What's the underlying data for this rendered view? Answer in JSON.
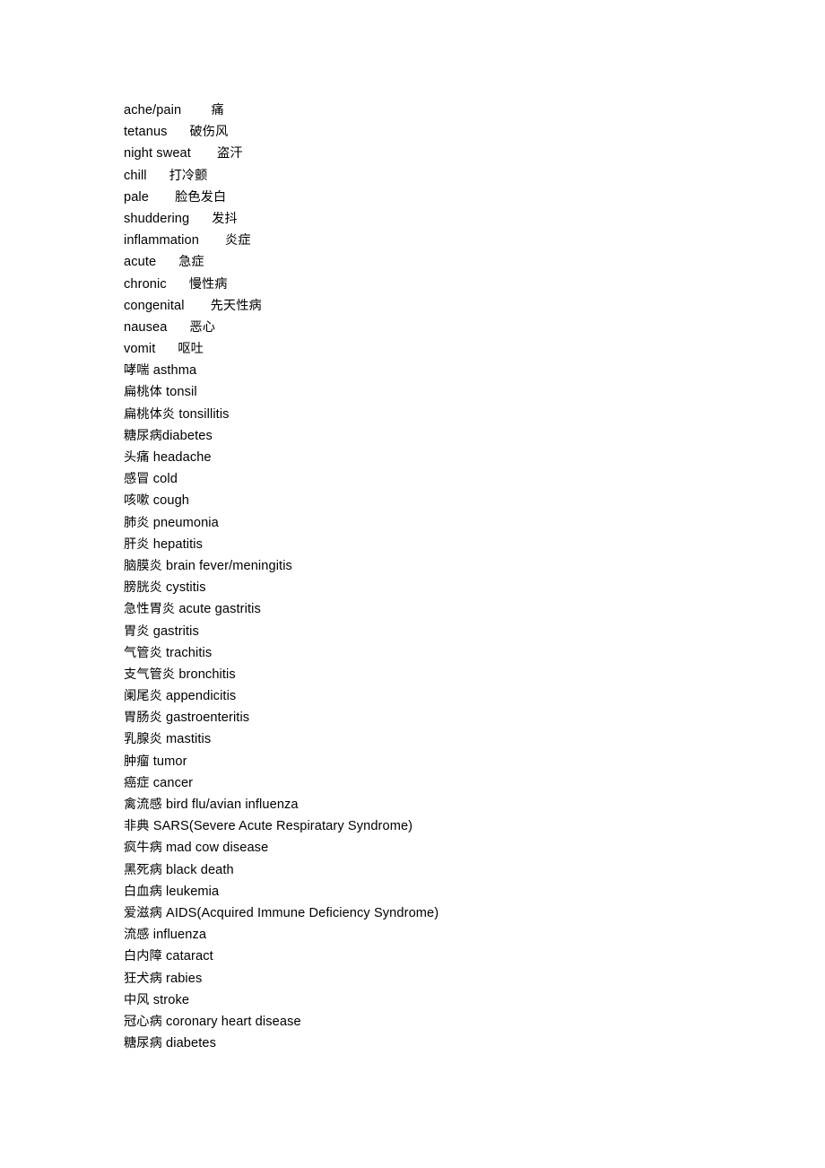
{
  "document": {
    "type": "vocabulary-list",
    "topic": "medical-terms-chinese-english",
    "page_background": "#ffffff",
    "text_color": "#000000",
    "entries": [
      {
        "order": "en-first",
        "english": "ache/pain",
        "gap": "        ",
        "chinese": "痛"
      },
      {
        "order": "en-first",
        "english": "tetanus",
        "gap": "      ",
        "chinese": "破伤风"
      },
      {
        "order": "en-first",
        "english": "night sweat",
        "gap": "       ",
        "chinese": "盗汗"
      },
      {
        "order": "en-first",
        "english": "chill",
        "gap": "      ",
        "chinese": "打冷颤"
      },
      {
        "order": "en-first",
        "english": "pale",
        "gap": "       ",
        "chinese": "脸色发白"
      },
      {
        "order": "en-first",
        "english": "shuddering",
        "gap": "      ",
        "chinese": "发抖"
      },
      {
        "order": "en-first",
        "english": "inflammation",
        "gap": "       ",
        "chinese": "炎症"
      },
      {
        "order": "en-first",
        "english": "acute",
        "gap": "      ",
        "chinese": "急症"
      },
      {
        "order": "en-first",
        "english": "chronic",
        "gap": "      ",
        "chinese": "慢性病"
      },
      {
        "order": "en-first",
        "english": "congenital",
        "gap": "       ",
        "chinese": "先天性病"
      },
      {
        "order": "en-first",
        "english": "nausea",
        "gap": "      ",
        "chinese": "恶心"
      },
      {
        "order": "en-first",
        "english": "vomit",
        "gap": "      ",
        "chinese": "呕吐"
      },
      {
        "order": "cn-first",
        "chinese": "哮喘",
        "gap": " ",
        "english": "asthma"
      },
      {
        "order": "cn-first",
        "chinese": "扁桃体",
        "gap": " ",
        "english": "tonsil"
      },
      {
        "order": "cn-first",
        "chinese": "扁桃体炎",
        "gap": " ",
        "english": "tonsillitis"
      },
      {
        "order": "cn-first",
        "chinese": "糖尿病",
        "gap": "",
        "english": "diabetes"
      },
      {
        "order": "cn-first",
        "chinese": "头痛",
        "gap": " ",
        "english": "headache"
      },
      {
        "order": "cn-first",
        "chinese": "感冒",
        "gap": " ",
        "english": "cold"
      },
      {
        "order": "cn-first",
        "chinese": "咳嗽",
        "gap": " ",
        "english": "cough"
      },
      {
        "order": "cn-first",
        "chinese": "肺炎",
        "gap": " ",
        "english": "pneumonia"
      },
      {
        "order": "cn-first",
        "chinese": "肝炎",
        "gap": " ",
        "english": "hepatitis"
      },
      {
        "order": "cn-first",
        "chinese": "脑膜炎",
        "gap": " ",
        "english": "brain fever/meningitis"
      },
      {
        "order": "cn-first",
        "chinese": "膀胱炎",
        "gap": " ",
        "english": "cystitis"
      },
      {
        "order": "cn-first",
        "chinese": "急性胃炎",
        "gap": " ",
        "english": "acute gastritis"
      },
      {
        "order": "cn-first",
        "chinese": "胃炎",
        "gap": " ",
        "english": "gastritis"
      },
      {
        "order": "cn-first",
        "chinese": "气管炎",
        "gap": " ",
        "english": "trachitis"
      },
      {
        "order": "cn-first",
        "chinese": "支气管炎",
        "gap": " ",
        "english": "bronchitis"
      },
      {
        "order": "cn-first",
        "chinese": "阑尾炎",
        "gap": " ",
        "english": "appendicitis"
      },
      {
        "order": "cn-first",
        "chinese": "胃肠炎",
        "gap": " ",
        "english": "gastroenteritis"
      },
      {
        "order": "cn-first",
        "chinese": "乳腺炎",
        "gap": " ",
        "english": "mastitis"
      },
      {
        "order": "cn-first",
        "chinese": "肿瘤",
        "gap": " ",
        "english": "tumor"
      },
      {
        "order": "cn-first",
        "chinese": "癌症",
        "gap": " ",
        "english": "cancer"
      },
      {
        "order": "cn-first",
        "chinese": "禽流感",
        "gap": " ",
        "english": "bird flu/avian influenza"
      },
      {
        "order": "cn-first",
        "chinese": "非典",
        "gap": " ",
        "english": "SARS(Severe Acute Respiratary Syndrome)"
      },
      {
        "order": "cn-first",
        "chinese": "疯牛病",
        "gap": " ",
        "english": "mad cow disease"
      },
      {
        "order": "cn-first",
        "chinese": "黑死病",
        "gap": " ",
        "english": "black death"
      },
      {
        "order": "cn-first",
        "chinese": "白血病",
        "gap": " ",
        "english": "leukemia"
      },
      {
        "order": "cn-first",
        "chinese": "爱滋病",
        "gap": " ",
        "english": "AIDS(Acquired Immune Deficiency Syndrome)"
      },
      {
        "order": "cn-first",
        "chinese": "流感",
        "gap": " ",
        "english": "influenza"
      },
      {
        "order": "cn-first",
        "chinese": "白内障",
        "gap": " ",
        "english": "cataract"
      },
      {
        "order": "cn-first",
        "chinese": "狂犬病",
        "gap": " ",
        "english": "rabies"
      },
      {
        "order": "cn-first",
        "chinese": "中风",
        "gap": " ",
        "english": "stroke"
      },
      {
        "order": "cn-first",
        "chinese": "冠心病",
        "gap": " ",
        "english": "coronary heart disease"
      },
      {
        "order": "cn-first",
        "chinese": "糖尿病",
        "gap": " ",
        "english": "diabetes"
      }
    ]
  }
}
